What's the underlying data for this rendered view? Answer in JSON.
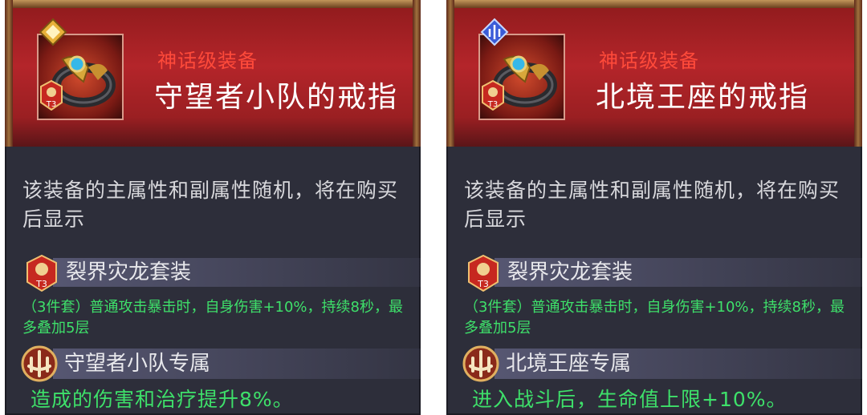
{
  "cards": [
    {
      "rarity": "神话级装备",
      "name": "守望者小队的戒指",
      "description": "该装备的主属性和副属性随机，将在购买后显示",
      "set_name": "裂界灾龙套装",
      "set_effect": "（3件套）普通攻击暴击时，自身伤害+10%，持续8秒，最多叠加5层",
      "exclusive_name": "守望者小队专属",
      "exclusive_effect": "造成的伤害和治疗提升8%。",
      "tier": "T3",
      "corner_badge_color": "#e8b13a"
    },
    {
      "rarity": "神话级装备",
      "name": "北境王座的戒指",
      "description": "该装备的主属性和副属性随机，将在购买后显示",
      "set_name": "裂界灾龙套装",
      "set_effect": "（3件套）普通攻击暴击时，自身伤害+10%，持续8秒，最多叠加5层",
      "exclusive_name": "北境王座专属",
      "exclusive_effect": "进入战斗后，生命值上限+10%。",
      "tier": "T3",
      "corner_badge_color": "#3a5cd8"
    }
  ],
  "colors": {
    "rarity_text": "#ff4a3a",
    "effect_text": "#3ee06a",
    "panel_bg": "#2d2e3a",
    "header_red": "#b4252a"
  }
}
